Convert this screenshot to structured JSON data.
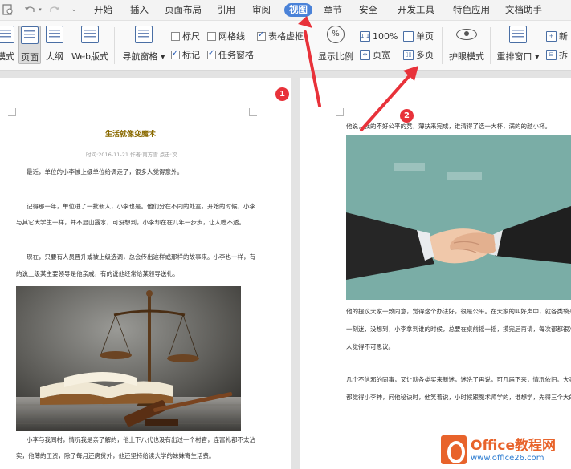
{
  "menubar": {
    "quick_access": [
      "save",
      "print-preview",
      "undo",
      "redo",
      "dropdown"
    ],
    "tabs": [
      "开始",
      "插入",
      "页面布局",
      "引用",
      "审阅",
      "视图",
      "章节",
      "安全",
      "开发工具",
      "特色应用",
      "文档助手"
    ],
    "active_tab": "视图"
  },
  "ribbon": {
    "view_modes": {
      "full_screen_label": "模式",
      "page_label": "页面",
      "outline_label": "大纲",
      "web_label": "Web版式"
    },
    "nav_pane_label": "导航窗格",
    "checks": {
      "ruler": {
        "label": "标尺",
        "checked": false
      },
      "gridlines": {
        "label": "网格线",
        "checked": false
      },
      "table_borders": {
        "label": "表格虚框",
        "checked": true
      },
      "marks": {
        "label": "标记",
        "checked": true
      },
      "task_pane": {
        "label": "任务窗格",
        "checked": true
      }
    },
    "zoom": {
      "ratio_label": "显示比例",
      "hundred_label": "100%",
      "page_width_label": "页宽",
      "single_page_label": "单页",
      "multi_page_label": "多页"
    },
    "eye_mode_label": "护眼模式",
    "rearrange_label": "重排窗口",
    "new_window_label": "新",
    "split_label": "拆"
  },
  "document": {
    "left_page": {
      "title": "生活就像变魔术",
      "meta": "时间:2016-11-21  作者:南方雪  点击:次",
      "paragraphs": [
        "最近，单位的小李被上级单位给调走了，很多人觉得意外。",
        "记得那一年，单位进了一批新人，小李也是。他们分在不同的处室，开始的时候，小李",
        "与其它大学生一样，并不显山露水，可没想到，小李却在在几年一步步，让人瞠不透。",
        "现在，只要有人员晋升或被上级选调，总会传出这样或那样的故事来。小李也一样，有",
        "的说上级某主要领导是他亲戚，有的说他经常给某领导送礼。",
        "小李与我同村，情况我是亲了解的，他上下八代也没有出过一个村官，连富礼都不太沾",
        "实，他薄的工资，除了每月还房贷外，他还坚持给读大学的妹妹寄生活费。"
      ]
    },
    "right_page": {
      "top_line": "他说，我的不好公平的竞，薄扶来完成，谁清得了选一大杯，满的的越小杯。",
      "paragraphs": [
        "他的提议大家一致同意，觉得这个办法好，很是公平。在大家的叫好声中，就各类袋来",
        "一刻迷，没想到，小李拿到谁的时候，总要在桌前摇一摇，摸完后再请，每次都都很准，让",
        "人觉得不可思议。",
        "几个不信邪的同事，又让就各类买来新迷，迷洗了再说，可几届下来，情况依旧。大家",
        "都觉得小李神，问他秘诀时，他笑着说，小时候跟魔术师学的，谁想学，先得三个大的。"
      ]
    },
    "badges": [
      "1",
      "2"
    ]
  },
  "watermark": {
    "brand": "Office教程网",
    "url": "www.office26.com"
  },
  "colors": {
    "active_tab": "#4a82d8",
    "badge": "#e8323a",
    "arrow": "#e8323a",
    "title": "#8a6a00",
    "logo_orange": "#e8632b",
    "logo_blue": "#2b7bd0",
    "handshake_bg": "#7aada6"
  }
}
